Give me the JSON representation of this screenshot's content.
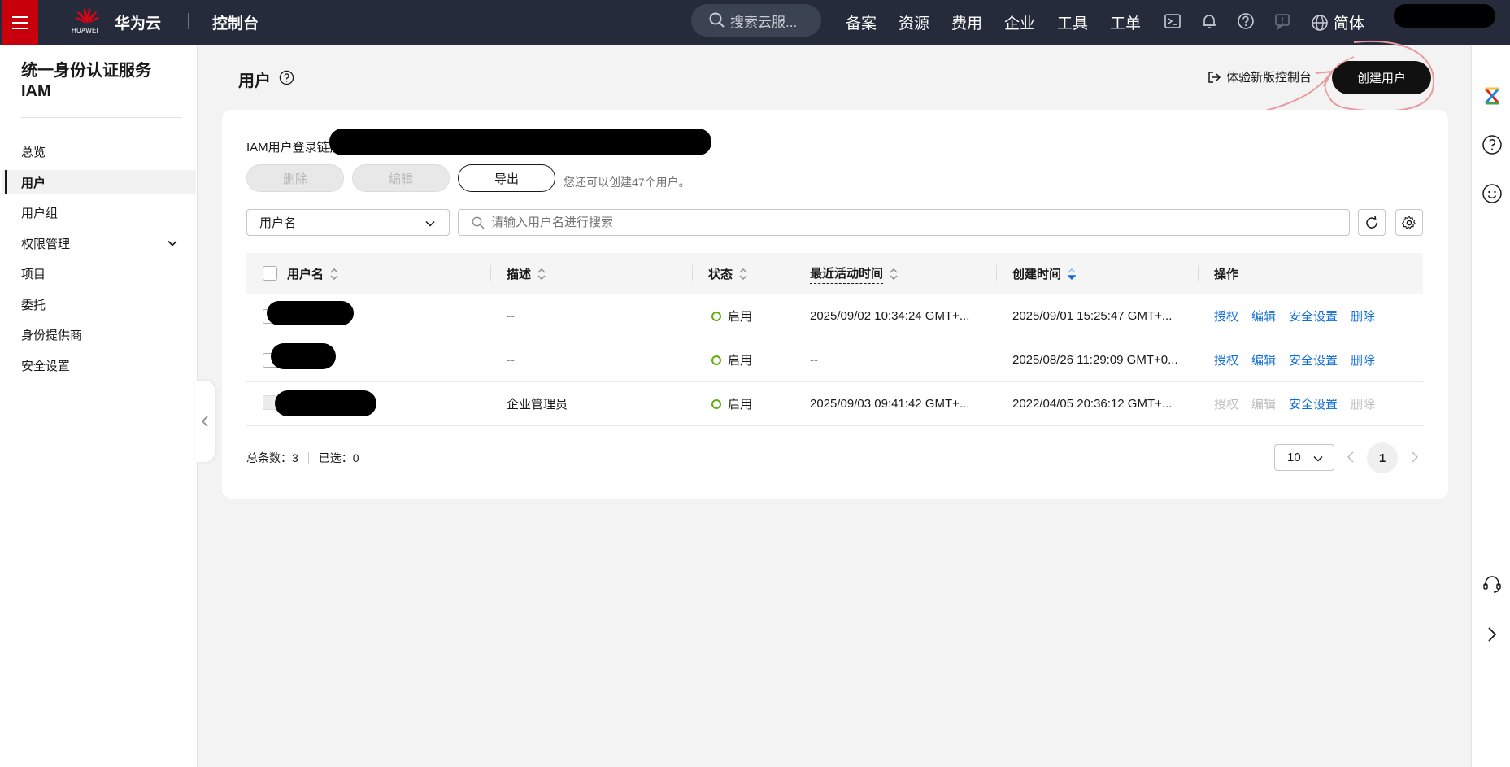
{
  "topbar": {
    "brand": "华为云",
    "logo_text": "HUAWEI",
    "console": "控制台",
    "search_placeholder": "搜索云服...",
    "nav": [
      "备案",
      "资源",
      "费用",
      "企业",
      "工具",
      "工单"
    ],
    "lang": "简体",
    "icons": [
      "terminal-icon",
      "bell-icon",
      "help-icon",
      "feedback-icon",
      "globe-icon"
    ]
  },
  "sidebar": {
    "service_title_line1": "统一身份认证服务",
    "service_title_line2": "IAM",
    "items": [
      {
        "label": "总览",
        "active": false
      },
      {
        "label": "用户",
        "active": true
      },
      {
        "label": "用户组",
        "active": false
      },
      {
        "label": "权限管理",
        "active": false,
        "expandable": true
      },
      {
        "label": "项目",
        "active": false
      },
      {
        "label": "委托",
        "active": false
      },
      {
        "label": "身份提供商",
        "active": false
      },
      {
        "label": "安全设置",
        "active": false
      }
    ]
  },
  "page": {
    "title": "用户",
    "new_console": "体验新版控制台",
    "create_user": "创建用户",
    "login_link_label": "IAM用户登录链接",
    "buttons": {
      "delete": "删除",
      "edit": "编辑",
      "export": "导出"
    },
    "quota_text": "您还可以创建47个用户。",
    "filter_select": "用户名",
    "search_placeholder": "请输入用户名进行搜索"
  },
  "table": {
    "columns": [
      "用户名",
      "描述",
      "状态",
      "最近活动时间",
      "创建时间",
      "操作"
    ],
    "rows": [
      {
        "description": "--",
        "status": "启用",
        "last_active": "2025/09/02 10:34:24 GMT+...",
        "created": "2025/09/01 15:25:47 GMT+...",
        "actions_enabled": true
      },
      {
        "description": "--",
        "status": "启用",
        "last_active": "--",
        "created": "2025/08/26 11:29:09 GMT+0...",
        "actions_enabled": true
      },
      {
        "description": "企业管理员",
        "status": "启用",
        "last_active": "2025/09/03 09:41:42 GMT+...",
        "created": "2022/04/05 20:36:12 GMT+...",
        "actions_enabled": false
      }
    ],
    "actions": [
      "授权",
      "编辑",
      "安全设置",
      "删除"
    ]
  },
  "footer": {
    "total_label": "总条数：3",
    "selected_label": "已选：0",
    "page_size": "10",
    "current_page": "1"
  },
  "colors": {
    "topbar_bg": "#252b3a",
    "brand_red": "#c7000b",
    "link_blue": "#0f6dd8",
    "status_green": "#5fae0b",
    "sort_active": "#0f6dd8"
  }
}
